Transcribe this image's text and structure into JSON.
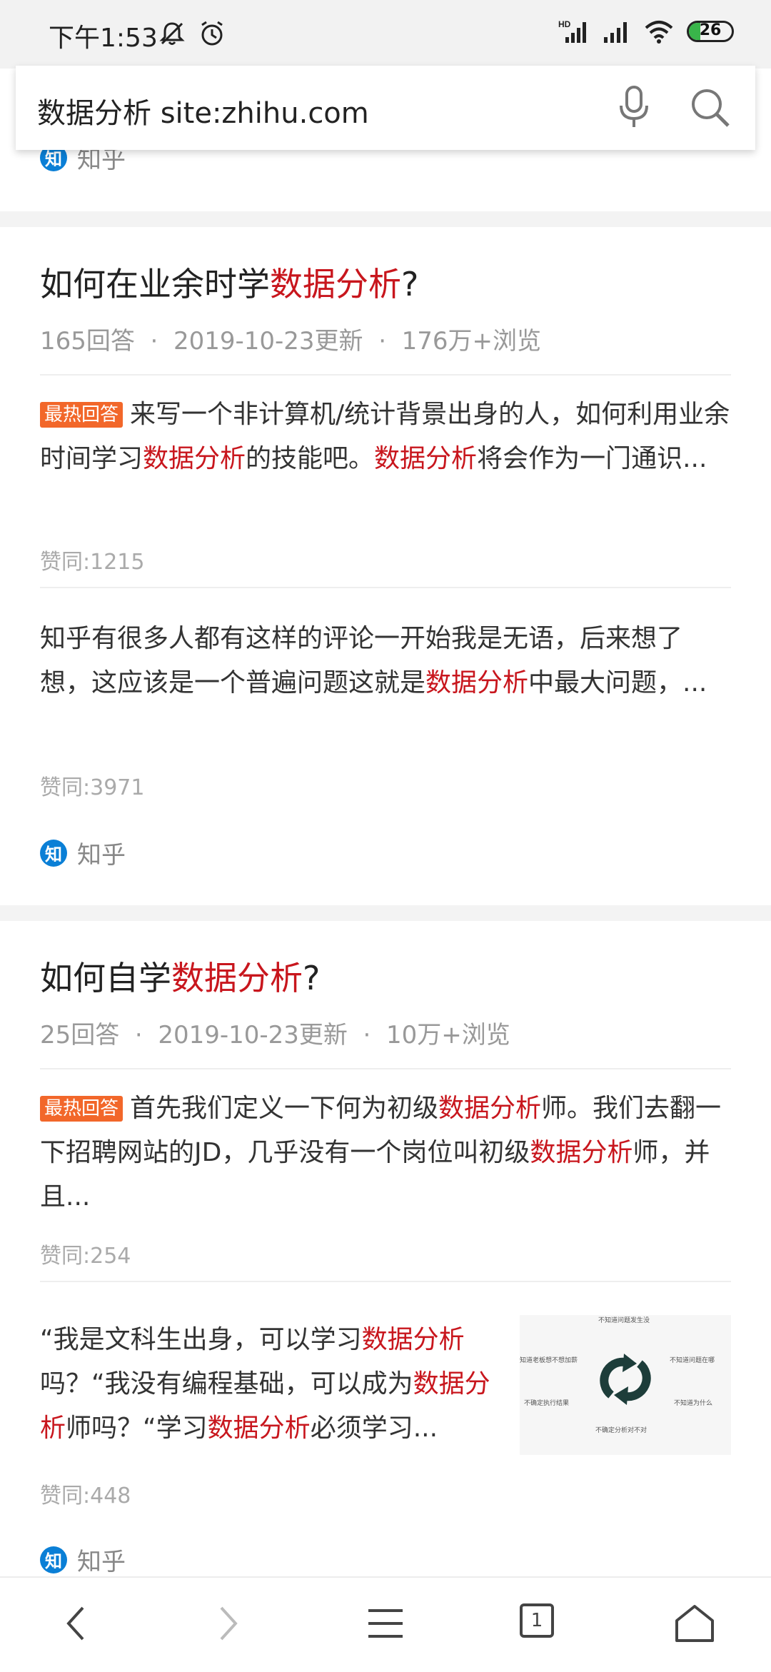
{
  "status_bar": {
    "time": "下午1:53",
    "battery_level": "26",
    "icons": [
      "mute-icon",
      "alarm-icon",
      "hd-signal-icon",
      "signal-icon",
      "wifi-icon",
      "battery-icon"
    ]
  },
  "search": {
    "query": "数据分析 site:zhihu.com",
    "icons": [
      "mic-icon",
      "search-icon"
    ]
  },
  "previous_result": {
    "source": "知乎",
    "source_badge": "知"
  },
  "results": [
    {
      "title_prefix": "如何在业余时学",
      "title_highlight": "数据分析",
      "title_suffix": "?",
      "answers": "165回答",
      "updated": "2019-10-23更新",
      "views": "176万+浏览",
      "dot": "·",
      "snippets": [
        {
          "badge": "最热回答",
          "p1": "来写一个非计算机/统计背景出身的人，如何利用业余时间学习",
          "h1": "数据分析",
          "p2": "的技能吧。",
          "h2": "数据分析",
          "p3": "将会作为一门通识...",
          "likes": "赞同:1215"
        },
        {
          "p1": "知乎有很多人都有这样的评论一开始我是无语，后来想了想，这应该是一个普遍问题这就是",
          "h1": "数据分析",
          "p2": "中最大问题，...",
          "likes": "赞同:3971"
        }
      ],
      "source": "知乎",
      "source_badge": "知"
    },
    {
      "title_prefix": "如何自学",
      "title_highlight": "数据分析",
      "title_suffix": "?",
      "answers": "25回答",
      "updated": "2019-10-23更新",
      "views": "10万+浏览",
      "dot": "·",
      "snippets": [
        {
          "badge": "最热回答",
          "p1": "首先我们定义一下何为初级",
          "h1": "数据分析",
          "p2": "师。我们去翻一下招聘网站的JD，几乎没有一个岗位叫初级",
          "h2": "数据分析",
          "p3": "师，并且...",
          "likes": "赞同:254"
        },
        {
          "p1": "“我是文科生出身，可以学习",
          "h1": "数据分析",
          "p2": "吗？“我没有编程基础，可以成为",
          "h2": "数据分析",
          "p3": "师吗？“学习",
          "h3": "数据分析",
          "p4": "必须学习...",
          "likes": "赞同:448",
          "thumbnail_labels": [
            "不知道问题发生没",
            "知道老板想不想加薪",
            "不知道问题在哪",
            "不确定执行结果",
            "不知道为什么",
            "不确定分析对不对"
          ]
        }
      ],
      "source": "知乎",
      "source_badge": "知"
    }
  ],
  "bottom_nav": {
    "tab_count": "1"
  }
}
